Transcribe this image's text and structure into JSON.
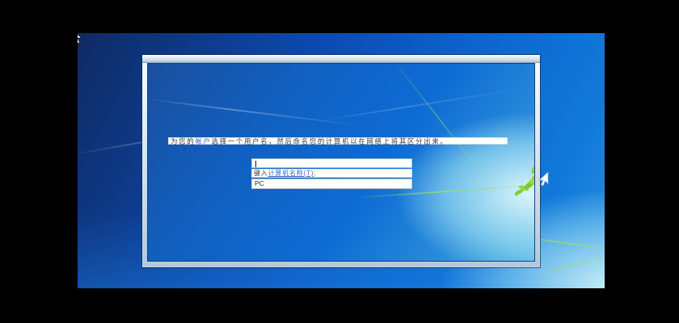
{
  "screen": {
    "description_label": "Windows 7 setup screen",
    "instruction": {
      "prefix": "为您的",
      "account_link": "帐户",
      "suffix": "选择一个用户名，然后命名您的计算机以在网络上将其区分出来。"
    },
    "username_input": {
      "value": "",
      "caret_visible": true
    },
    "computer_name_label": {
      "prefix": "键入",
      "link": "计算机名称(T)",
      "suffix": ":"
    },
    "computer_name_input": {
      "value": "PC"
    },
    "icons": {
      "main_cursor": "arrow-cursor",
      "secondary_cursor": "arrow-cursor-left",
      "sprig": "leaf-sprig"
    },
    "colors": {
      "letterbox": "#000000",
      "wallpaper_dark": "#0f2a62",
      "wallpaper_blue": "#0c64cc",
      "glow_cyan": "#c9f2f8",
      "frame_light": "#dde9f2",
      "interior_blue": "#0d6bd4",
      "sprig_green": "#7dc72f",
      "link_blue": "#3c66cc",
      "field_bg": "#ffffff",
      "text_dark": "#3b3b3b"
    }
  }
}
